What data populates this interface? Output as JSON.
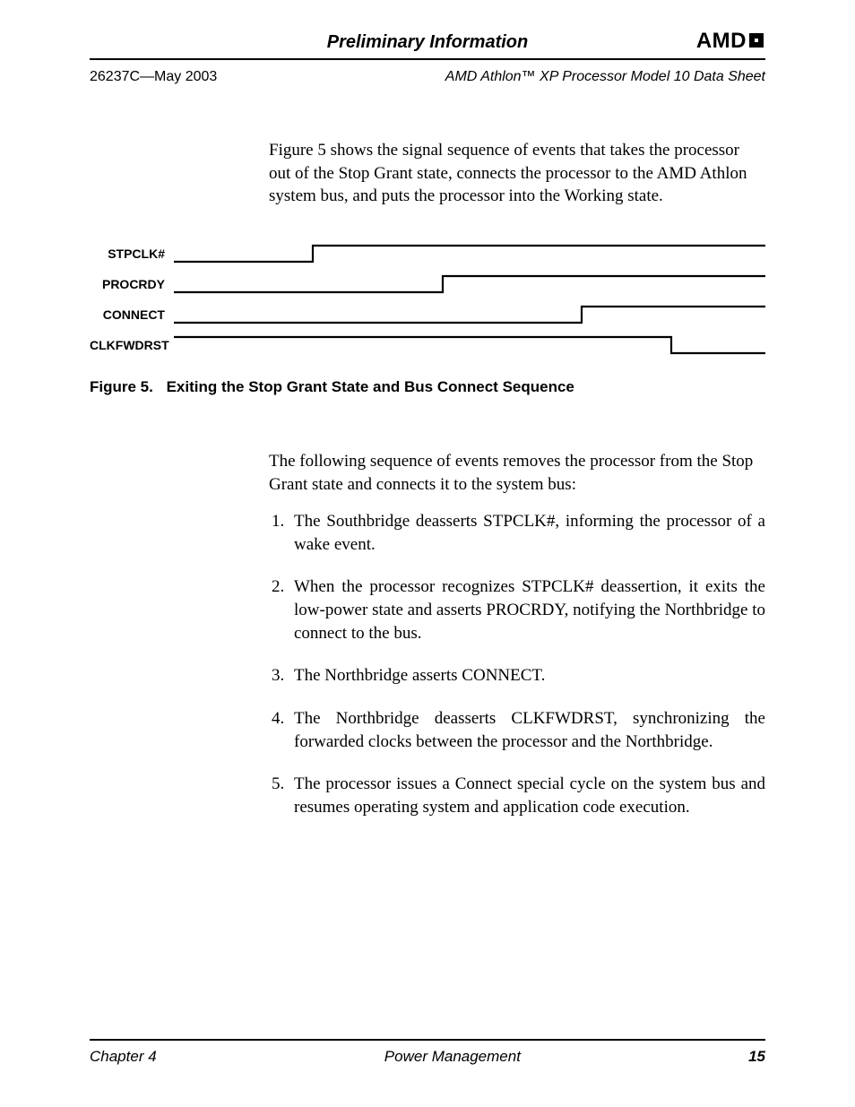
{
  "header": {
    "prelim": "Preliminary Information",
    "logo": "AMD",
    "doc_left": "26237C—May 2003",
    "doc_right": "AMD Athlon™ XP Processor Model 10 Data Sheet"
  },
  "intro": "Figure 5 shows the signal sequence of events that takes the processor out of the Stop Grant state, connects the processor to the AMD Athlon system bus, and puts the processor into the Working state.",
  "signals": {
    "s1": "STPCLK#",
    "s2": "PROCRDY",
    "s3": "CONNECT",
    "s4": "CLKFWDRST"
  },
  "figure": {
    "label": "Figure 5.",
    "caption": "Exiting the Stop Grant State and Bus Connect Sequence"
  },
  "following": "The following sequence of events removes the processor from the Stop Grant state and connects it to the system bus:",
  "steps": {
    "1": "The Southbridge deasserts STPCLK#, informing the processor of a wake event.",
    "2": "When the processor recognizes STPCLK# deassertion, it exits the low-power state and asserts PROCRDY, notifying the Northbridge to connect to the bus.",
    "3": "The Northbridge asserts CONNECT.",
    "4": "The Northbridge deasserts CLKFWDRST, synchronizing the forwarded clocks between the processor and the Northbridge.",
    "5": "The processor issues a Connect special cycle on the system bus and resumes operating system and application code execution."
  },
  "footer": {
    "left": "Chapter 4",
    "center": "Power Management",
    "right": "15"
  }
}
